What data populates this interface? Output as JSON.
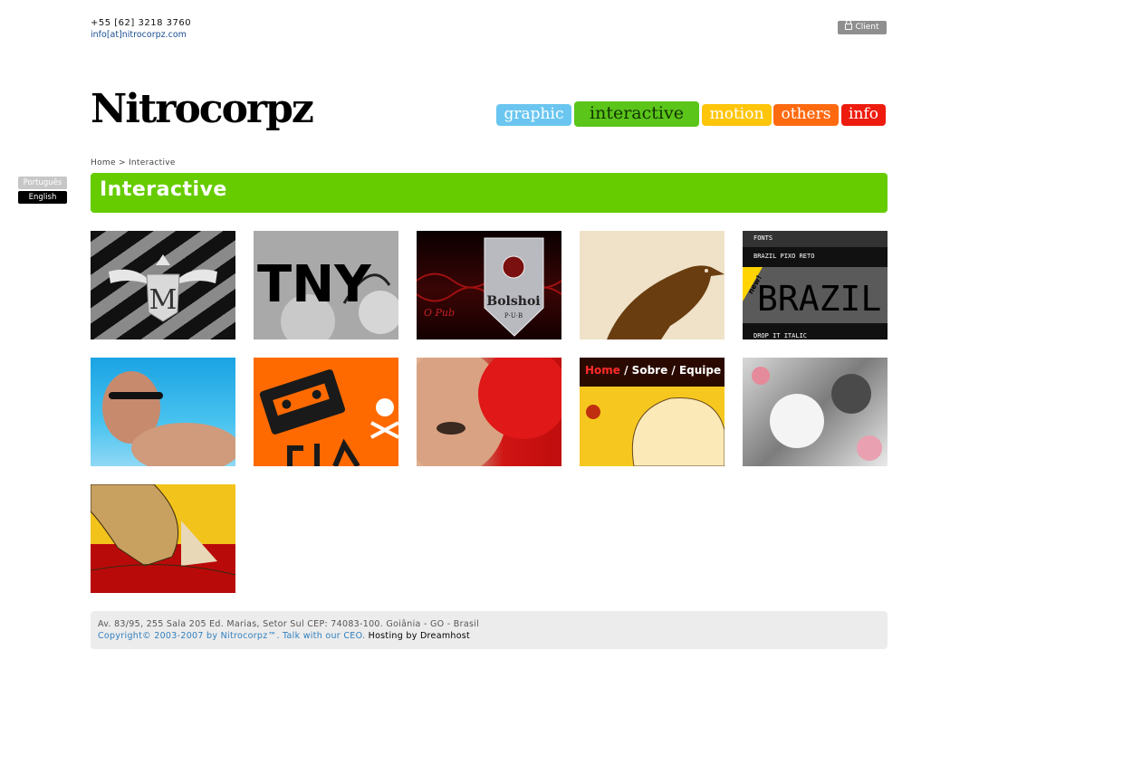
{
  "contact": {
    "phone": "+55 [62] 3218 3760",
    "email": "info[at]nitrocorpz.com"
  },
  "client_button": {
    "label": "Client",
    "icon": "lock-icon"
  },
  "logo": "Nitrocorpz",
  "nav": {
    "graphic": "graphic",
    "interactive": "interactive",
    "motion": "motion",
    "others": "others",
    "info": "info"
  },
  "colors": {
    "graphic": "#6ac6f0",
    "interactive": "#5bc51a",
    "motion": "#ffc50a",
    "others": "#ff6a10",
    "info": "#ee1c0e",
    "section_bar": "#66cc00"
  },
  "breadcrumb": "Home > Interactive",
  "languages": {
    "pt": "Português",
    "en": "English"
  },
  "section_title": "Interactive",
  "thumbnails": {
    "t2_text": "TNY",
    "t3_caption": "O Pub",
    "t3_crest": "Bolshoi",
    "t3_sub": "P·U·B",
    "t5_fonts": "FONTS",
    "t5_name": "BRAZIL PIXO RETO",
    "t5_big": "BRAZIL PIX",
    "t5_badge": "new!",
    "t5_bottom": "DROP IT ITALIC",
    "t9_nav_home": "Home",
    "t9_nav_rest": " / Sobre / Equipe"
  },
  "footer": {
    "address": "Av. 83/95, 255 Sala 205 Ed. Marias, Setor Sul CEP: 74083-100. Goiânia - GO - Brasil",
    "copyright": "Copyright© 2003-2007 by Nitrocorpz™. Talk with our CEO.",
    "hosting": "Hosting by Dreamhost"
  }
}
